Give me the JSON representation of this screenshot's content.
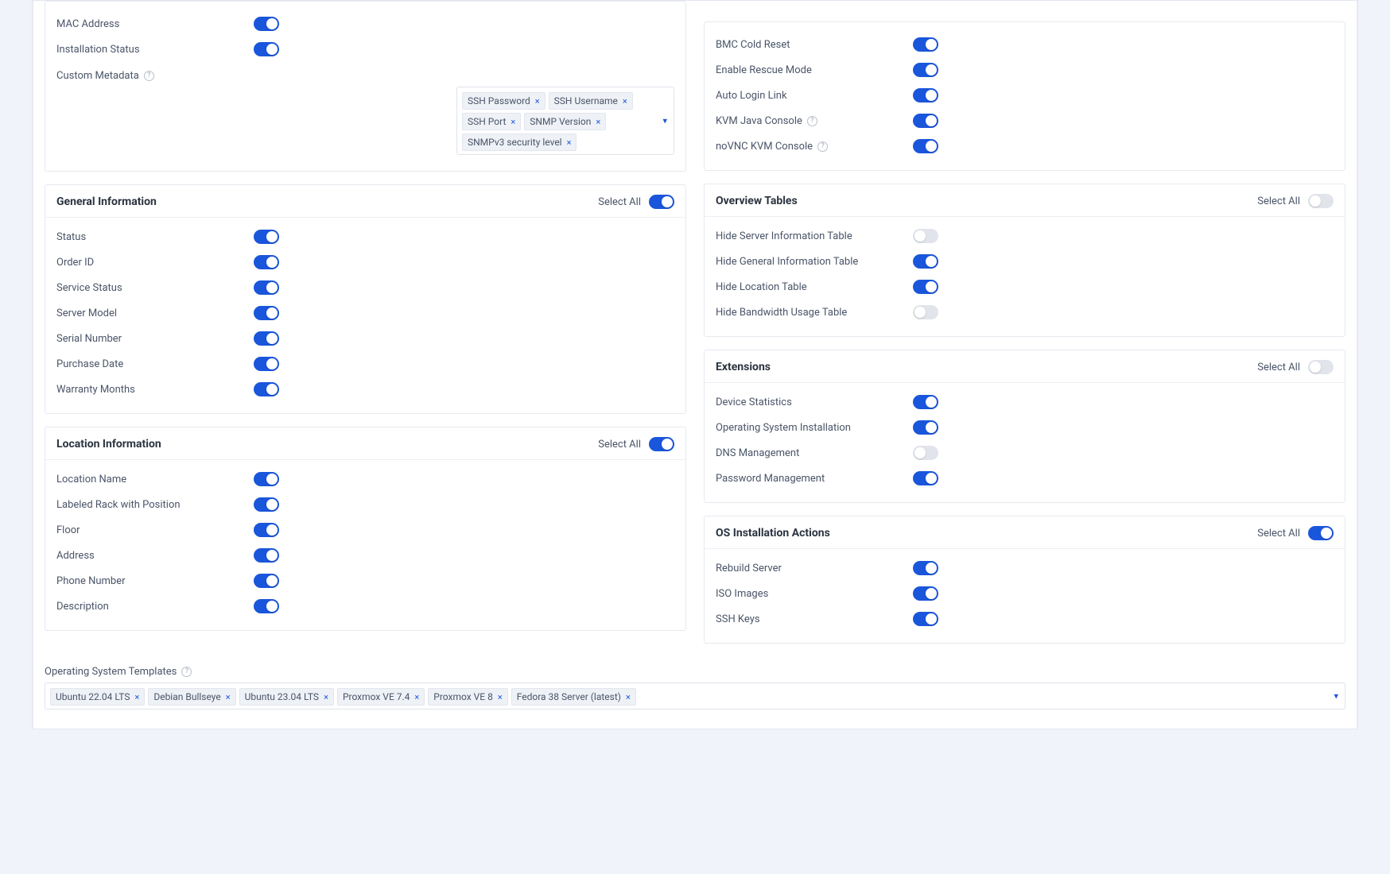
{
  "shared": {
    "select_all": "Select All"
  },
  "server_info_tail": {
    "rows": [
      {
        "label": "MAC Address",
        "on": true
      },
      {
        "label": "Installation Status",
        "on": true
      }
    ],
    "custom_meta_label": "Custom Metadata",
    "custom_meta_tags": [
      "SSH Password",
      "SSH Username",
      "SSH Port",
      "SNMP Version",
      "SNMPv3 security level"
    ]
  },
  "general": {
    "title": "General Information",
    "select_all_on": true,
    "rows": [
      {
        "label": "Status",
        "on": true
      },
      {
        "label": "Order ID",
        "on": true
      },
      {
        "label": "Service Status",
        "on": true
      },
      {
        "label": "Server Model",
        "on": true
      },
      {
        "label": "Serial Number",
        "on": true
      },
      {
        "label": "Purchase Date",
        "on": true
      },
      {
        "label": "Warranty Months",
        "on": true
      }
    ]
  },
  "location": {
    "title": "Location Information",
    "select_all_on": true,
    "rows": [
      {
        "label": "Location Name",
        "on": true
      },
      {
        "label": "Labeled Rack with Position",
        "on": true
      },
      {
        "label": "Floor",
        "on": true
      },
      {
        "label": "Address",
        "on": true
      },
      {
        "label": "Phone Number",
        "on": true
      },
      {
        "label": "Description",
        "on": true
      }
    ]
  },
  "actions_tail": {
    "rows": [
      {
        "label": "BMC Cold Reset",
        "on": true,
        "help": false
      },
      {
        "label": "Enable Rescue Mode",
        "on": true,
        "help": false
      },
      {
        "label": "Auto Login Link",
        "on": true,
        "help": false
      },
      {
        "label": "KVM Java Console",
        "on": true,
        "help": true
      },
      {
        "label": "noVNC KVM Console",
        "on": true,
        "help": true
      }
    ]
  },
  "overview": {
    "title": "Overview Tables",
    "select_all_on": false,
    "rows": [
      {
        "label": "Hide Server Information Table",
        "on": false
      },
      {
        "label": "Hide General Information Table",
        "on": true
      },
      {
        "label": "Hide Location Table",
        "on": true
      },
      {
        "label": "Hide Bandwidth Usage Table",
        "on": false
      }
    ]
  },
  "extensions": {
    "title": "Extensions",
    "select_all_on": false,
    "rows": [
      {
        "label": "Device Statistics",
        "on": true
      },
      {
        "label": "Operating System Installation",
        "on": true
      },
      {
        "label": "DNS Management",
        "on": false
      },
      {
        "label": "Password Management",
        "on": true
      }
    ]
  },
  "osactions": {
    "title": "OS Installation Actions",
    "select_all_on": true,
    "rows": [
      {
        "label": "Rebuild Server",
        "on": true
      },
      {
        "label": "ISO Images",
        "on": true
      },
      {
        "label": "SSH Keys",
        "on": true
      }
    ]
  },
  "os_templates": {
    "label": "Operating System Templates",
    "tags": [
      "Ubuntu 22.04 LTS",
      "Debian Bullseye",
      "Ubuntu 23.04 LTS",
      "Proxmox VE 7.4",
      "Proxmox VE 8",
      "Fedora 38 Server (latest)"
    ]
  }
}
